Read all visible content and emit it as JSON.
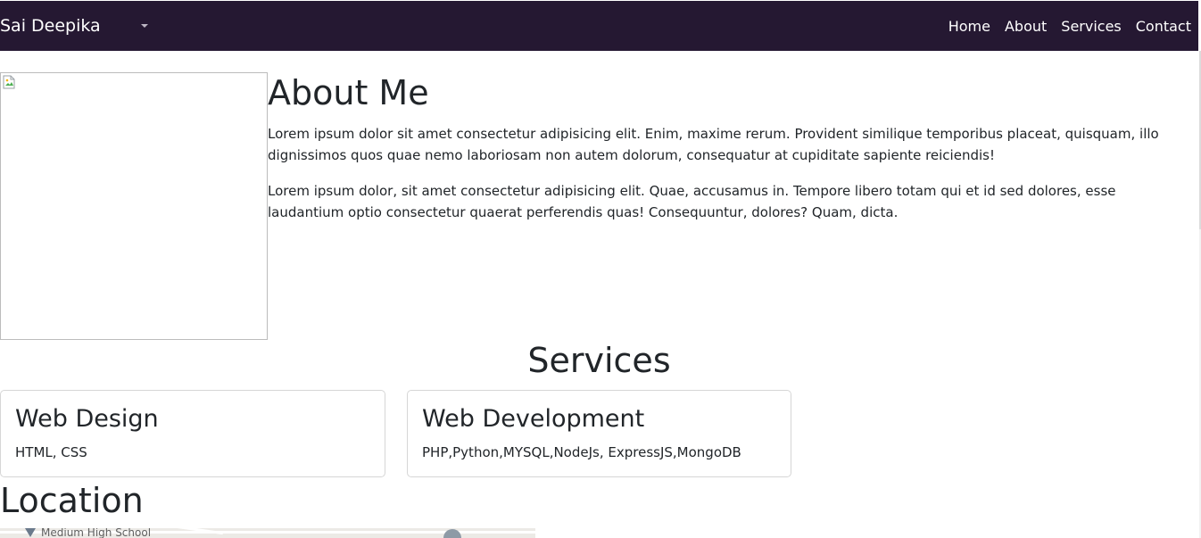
{
  "navbar": {
    "brand": "Sai Deepika",
    "links": [
      "Home",
      "About",
      "Services",
      "Contact"
    ],
    "bg_color": "#251832"
  },
  "about": {
    "title": "About Me",
    "paragraphs": [
      "Lorem ipsum dolor sit amet consectetur adipisicing elit. Enim, maxime rerum. Provident similique temporibus placeat, quisquam, illo dignissimos quos quae nemo laboriosam non autem dolorum, consequatur at cupiditate sapiente reiciendis!",
      "Lorem ipsum dolor, sit amet consectetur adipisicing elit. Quae, accusamus in. Tempore libero totam qui et id sed dolores, esse laudantium optio consectetur quaerat perferendis quas! Consequuntur, dolores? Quam, dicta."
    ]
  },
  "services": {
    "title": "Services",
    "cards": [
      {
        "title": "Web Design",
        "text": "HTML, CSS"
      },
      {
        "title": "Web Development",
        "text": "PHP,Python,MYSQL,NodeJs, ExpressJS,MongoDB"
      }
    ]
  },
  "location": {
    "title": "Location",
    "map_labels": [
      "Medium High School"
    ]
  }
}
